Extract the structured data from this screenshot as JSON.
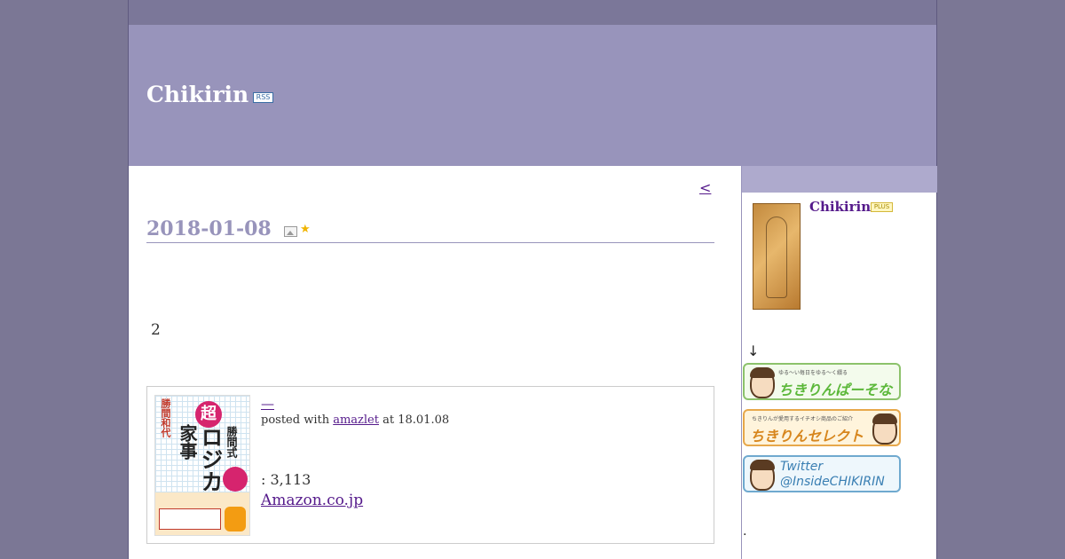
{
  "header": {
    "site_title": "Chikirin",
    "rss_label": "RSS"
  },
  "nav": {
    "prev_label": "<"
  },
  "entry": {
    "date": "2018-01-08",
    "body_text": "2"
  },
  "amazon": {
    "title_link": "—",
    "posted_prefix": "posted with ",
    "posted_via": "amazlet",
    "posted_suffix": " at 18.01.08",
    "price": ": 3,113",
    "store_link": "Amazon.co.jp",
    "book_cover": {
      "author": "勝間和代",
      "super": "超",
      "title_kanji": "家事",
      "title_main": "ロジカル",
      "title_style": "勝間式"
    }
  },
  "sidebar": {
    "profile_name": "Chikirin",
    "plus_label": "PLUS",
    "arrow": "↓",
    "banners": {
      "persona_sub": "ゆる〜い毎日をゆる〜く綴る",
      "persona_main": "ちきりんぱーそなる",
      "select_sub": "ちきりんが愛用するイチオシ商品のご紹介",
      "select_main": "ちきりんセレクト",
      "twitter_line1": "Twitter",
      "twitter_line2": "@InsideCHIKIRIN"
    },
    "dot": "."
  },
  "colors": {
    "background": "#7b7795",
    "header": "#9894bb",
    "topbar": "#7b7799",
    "date_color": "#9894bb",
    "link": "#551a8b"
  }
}
